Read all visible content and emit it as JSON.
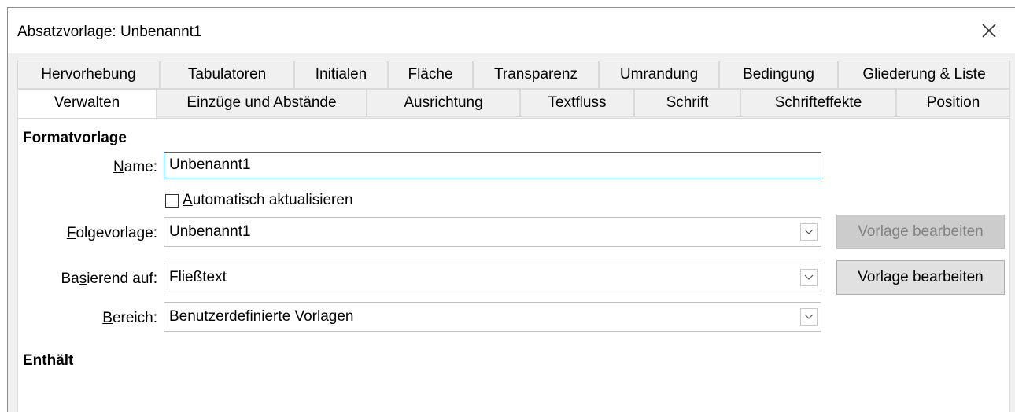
{
  "window": {
    "title": "Absatzvorlage: Unbenannt1"
  },
  "tabs_row1": [
    "Hervorhebung",
    "Tabulatoren",
    "Initialen",
    "Fläche",
    "Transparenz",
    "Umrandung",
    "Bedingung",
    "Gliederung & Liste"
  ],
  "tabs_row2": [
    "Verwalten",
    "Einzüge und Abstände",
    "Ausrichtung",
    "Textfluss",
    "Schrift",
    "Schrifteffekte",
    "Position"
  ],
  "active_tab": "Verwalten",
  "formatvorlage": {
    "heading": "Formatvorlage",
    "name_label": "Name:",
    "name_value": "Unbenannt1",
    "auto_update_label": "Automatisch aktualisieren",
    "auto_update_checked": false,
    "folge_label": "Folgevorlage:",
    "folge_value": "Unbenannt1",
    "basierend_label": "Basierend auf:",
    "basierend_value": "Fließtext",
    "bereich_label": "Bereich:",
    "bereich_value": "Benutzerdefinierte Vorlagen",
    "edit_button_disabled_label": "Vorlage bearbeiten",
    "edit_button_label": "Vorlage bearbeiten"
  },
  "enthaelt": {
    "heading": "Enthält"
  },
  "colors": {
    "focus_border": "#0078d7",
    "dialog_bg": "#f0f0f0",
    "panel_bg": "#ffffff"
  }
}
